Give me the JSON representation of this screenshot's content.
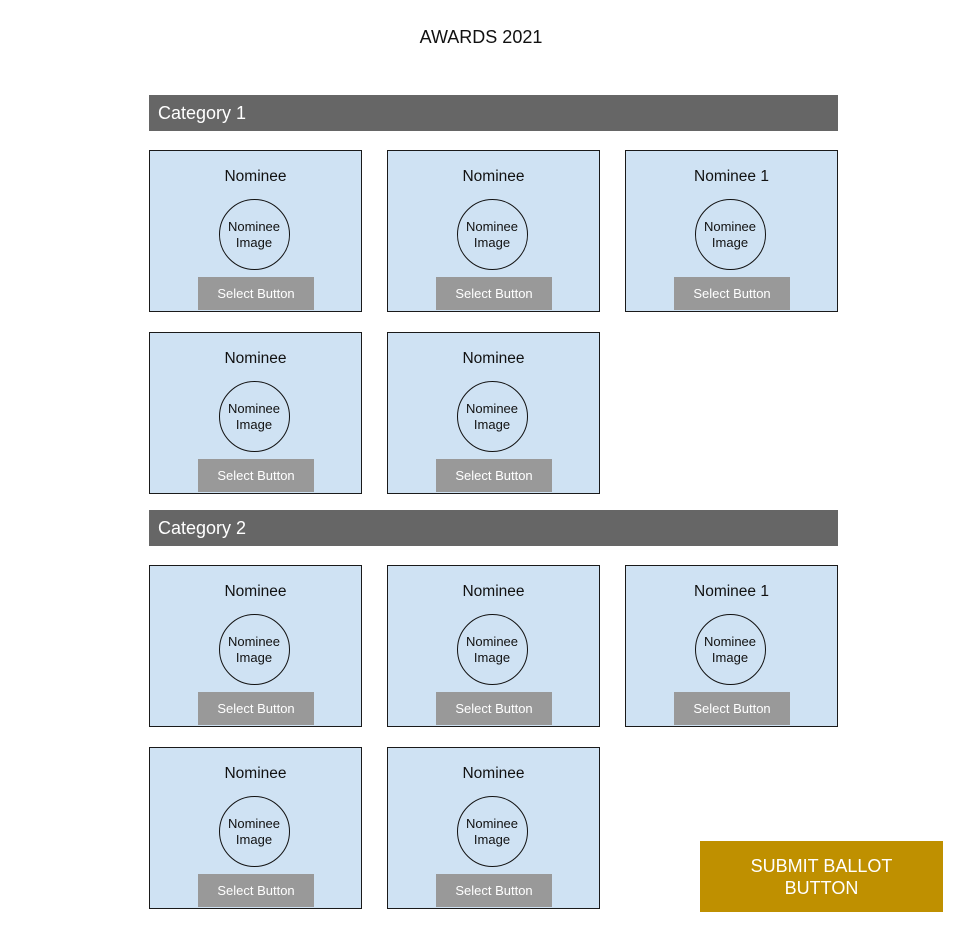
{
  "page": {
    "title": "AWARDS 2021"
  },
  "categories": [
    {
      "label": "Category 1",
      "nominees": [
        {
          "name": "Nominee",
          "image_label": "Nominee Image",
          "select_label": "Select Button"
        },
        {
          "name": "Nominee",
          "image_label": "Nominee Image",
          "select_label": "Select Button"
        },
        {
          "name": "Nominee 1",
          "image_label": "Nominee Image",
          "select_label": "Select Button"
        },
        {
          "name": "Nominee",
          "image_label": "Nominee Image",
          "select_label": "Select Button"
        },
        {
          "name": "Nominee",
          "image_label": "Nominee Image",
          "select_label": "Select Button"
        }
      ]
    },
    {
      "label": "Category 2",
      "nominees": [
        {
          "name": "Nominee",
          "image_label": "Nominee Image",
          "select_label": "Select Button"
        },
        {
          "name": "Nominee",
          "image_label": "Nominee Image",
          "select_label": "Select Button"
        },
        {
          "name": "Nominee 1",
          "image_label": "Nominee Image",
          "select_label": "Select Button"
        },
        {
          "name": "Nominee",
          "image_label": "Nominee Image",
          "select_label": "Select Button"
        },
        {
          "name": "Nominee",
          "image_label": "Nominee Image",
          "select_label": "Select Button"
        }
      ]
    }
  ],
  "submit": {
    "label": "SUBMIT BALLOT BUTTON"
  },
  "colors": {
    "category_bar": "#666666",
    "card_background": "#cfe2f3",
    "select_button": "#999999",
    "submit_button": "#bf9000"
  }
}
